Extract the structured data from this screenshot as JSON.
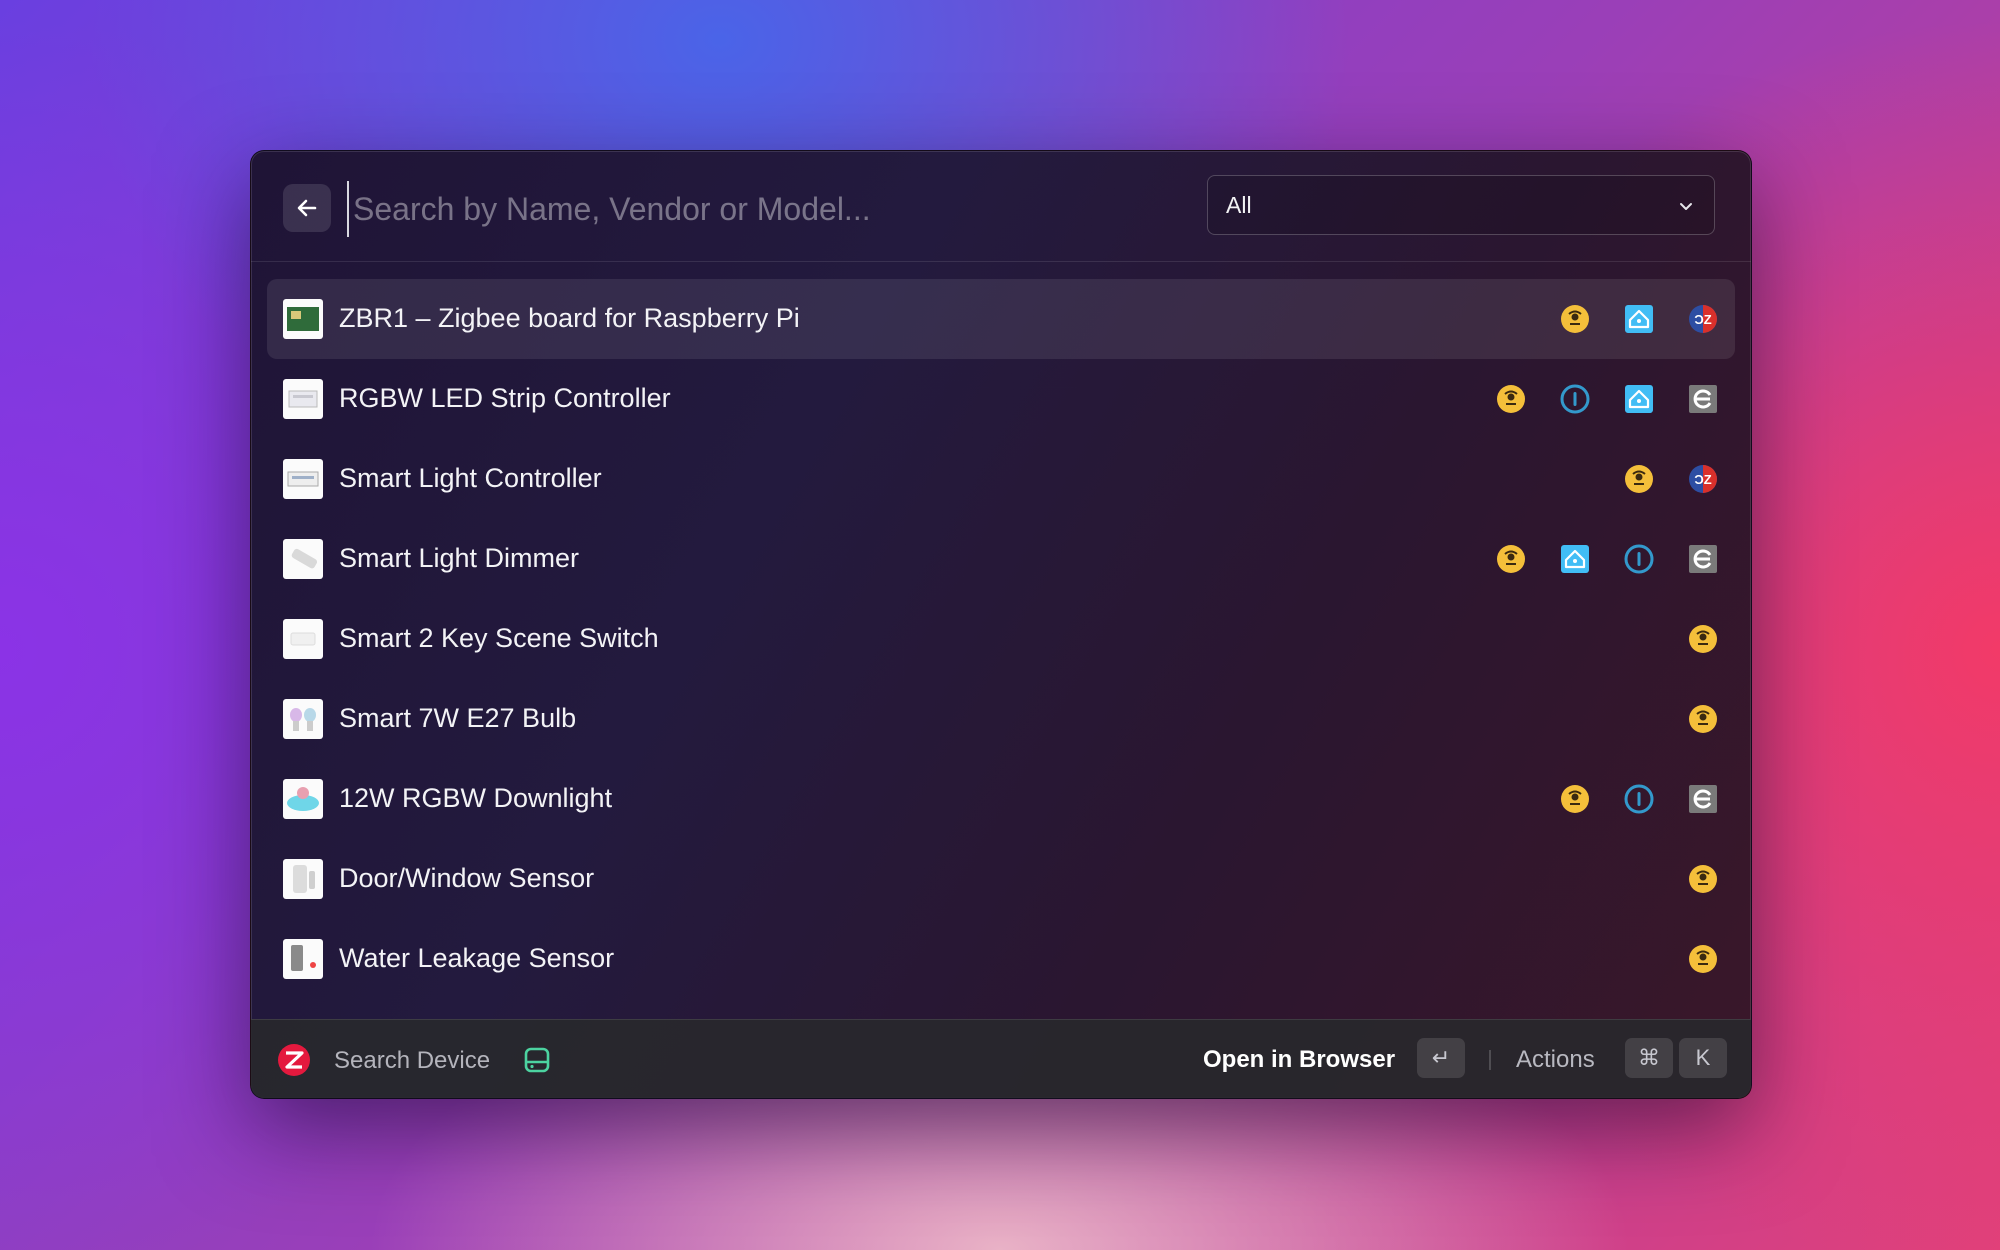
{
  "search": {
    "placeholder": "Search by Name, Vendor or Model...",
    "filter_value": "All"
  },
  "devices": [
    {
      "name": "ZBR1 – Zigbee board for Raspberry Pi",
      "selected": true,
      "integrations": [
        "mqtt",
        "home-assistant",
        "deconz"
      ]
    },
    {
      "name": "RGBW LED Strip Controller",
      "selected": false,
      "integrations": [
        "mqtt",
        "iobroker",
        "home-assistant",
        "esphome"
      ]
    },
    {
      "name": "Smart Light Controller",
      "selected": false,
      "integrations": [
        "mqtt",
        "deconz"
      ]
    },
    {
      "name": "Smart Light Dimmer",
      "selected": false,
      "integrations": [
        "mqtt",
        "home-assistant",
        "iobroker",
        "esphome"
      ]
    },
    {
      "name": "Smart 2 Key Scene Switch",
      "selected": false,
      "integrations": [
        "mqtt"
      ]
    },
    {
      "name": "Smart 7W E27 Bulb",
      "selected": false,
      "integrations": [
        "mqtt"
      ]
    },
    {
      "name": "12W RGBW Downlight",
      "selected": false,
      "integrations": [
        "mqtt",
        "iobroker",
        "esphome"
      ]
    },
    {
      "name": "Door/Window Sensor",
      "selected": false,
      "integrations": [
        "mqtt"
      ]
    },
    {
      "name": "Water Leakage Sensor",
      "selected": false,
      "integrations": [
        "mqtt"
      ]
    }
  ],
  "footer": {
    "title": "Search Device",
    "primary_action": "Open in Browser",
    "primary_shortcut": "↵",
    "actions_label": "Actions",
    "actions_shortcut_mod": "⌘",
    "actions_shortcut_key": "K"
  },
  "colors": {
    "mqtt": "#f4bf3a",
    "home_assistant": "#41bdf5",
    "iobroker": "#3399cc",
    "deconz_blue": "#2d4ea3",
    "deconz_red": "#d9302b",
    "esphome": "#7a7a7a",
    "drive_green": "#4cd3a0",
    "zigbee_red": "#e4193e"
  }
}
